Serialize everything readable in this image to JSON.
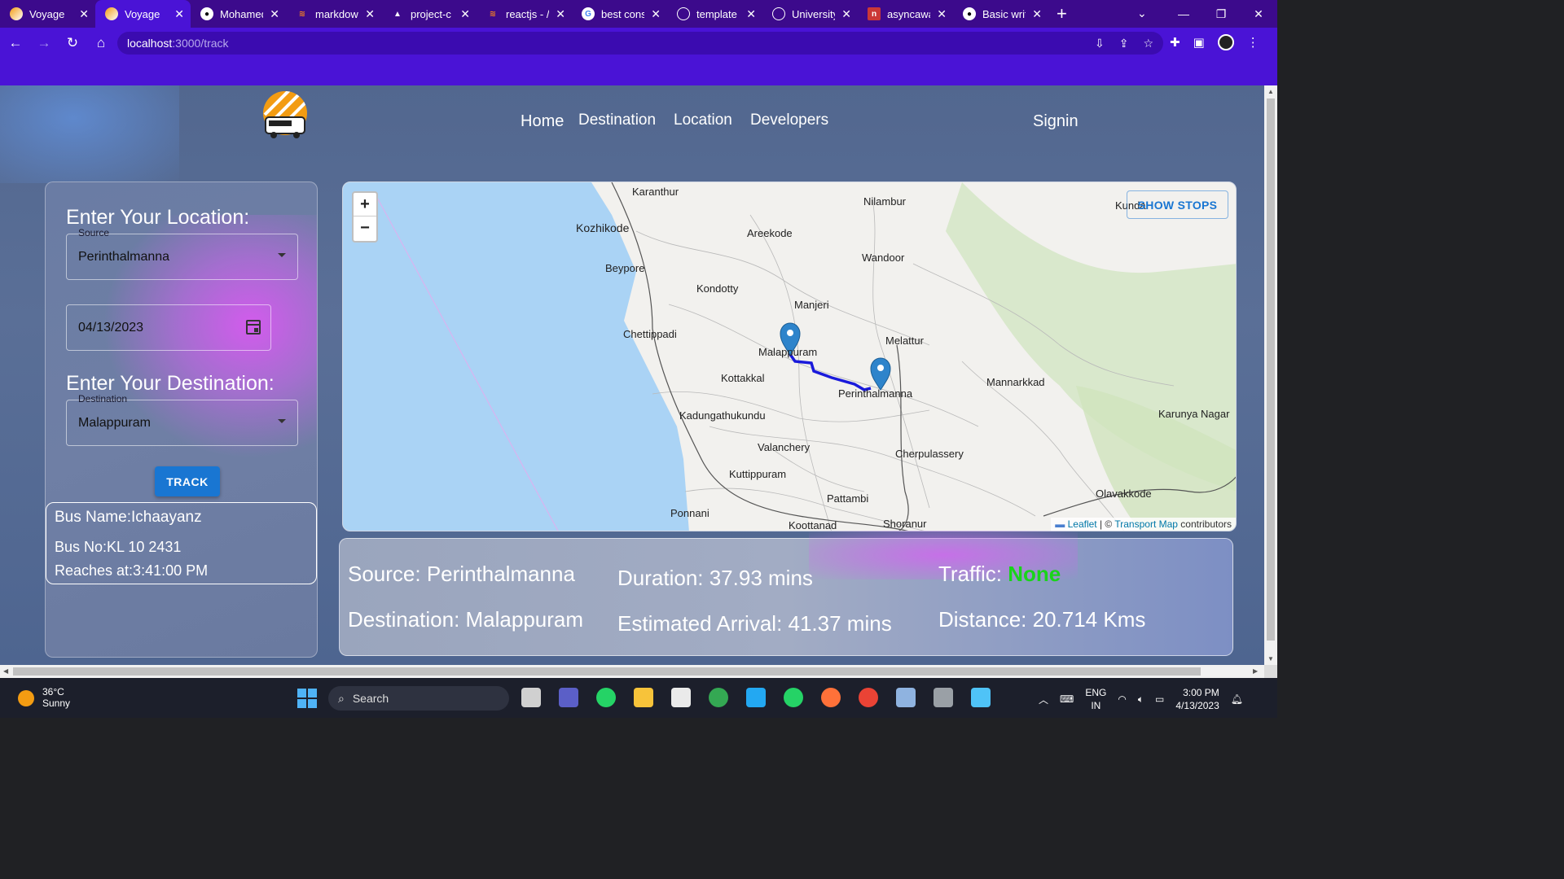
{
  "browser": {
    "tabs": [
      {
        "title": "Voyage",
        "icon": "voyage-favicon",
        "active": false
      },
      {
        "title": "Voyage",
        "icon": "voyage-favicon",
        "active": true
      },
      {
        "title": "Mohamed",
        "icon": "github-icon",
        "active": false
      },
      {
        "title": "markdow",
        "icon": "stackoverflow-icon",
        "active": false
      },
      {
        "title": "project-c",
        "icon": "vercel-icon",
        "active": false
      },
      {
        "title": "reactjs - /",
        "icon": "stackoverflow-icon",
        "active": false
      },
      {
        "title": "best cons",
        "icon": "google-icon",
        "active": false
      },
      {
        "title": "template",
        "icon": "globe-icon",
        "active": false
      },
      {
        "title": "University",
        "icon": "globe-icon",
        "active": false
      },
      {
        "title": "asyncawa",
        "icon": "npm-icon",
        "active": false
      },
      {
        "title": "Basic writ",
        "icon": "github-icon",
        "active": false
      }
    ],
    "url_host": "localhost",
    "url_path": ":3000/track"
  },
  "nav": {
    "home": "Home",
    "destination": "Destination",
    "location": "Location",
    "developers": "Developers",
    "signin": "Signin"
  },
  "form": {
    "location_heading": "Enter Your Location:",
    "source_label": "Source",
    "source_value": "Perinthalmanna",
    "date_value": "04/13/2023",
    "destination_heading": "Enter Your Destination:",
    "destination_label": "Destination",
    "destination_value": "Malappuram",
    "track_label": "TRACK"
  },
  "bus": {
    "name": "Bus Name:Ichaayanz",
    "number": "Bus No:KL 10 2431",
    "reaches": "Reaches at:3:41:00 PM"
  },
  "map": {
    "zoom_in": "+",
    "zoom_out": "−",
    "show_stops": "SHOW STOPS",
    "attribution_leaflet": "Leaflet",
    "attribution_sep": " | © ",
    "attribution_tm": "Transport Map",
    "attribution_tail": " contributors",
    "places": {
      "karanthur": "Karanthur",
      "kozhikode": "Kozhikode",
      "nilambur": "Nilambur",
      "kunda": "Kunda",
      "areekode": "Areekode",
      "beypore": "Beypore",
      "wandoor": "Wandoor",
      "kondotty": "Kondotty",
      "manjeri": "Manjeri",
      "chettippadi": "Chettippadi",
      "malappuram": "Malappuram",
      "melattur": "Melattur",
      "kottakkal": "Kottakkal",
      "perinthalmanna": "Perinthalmanna",
      "mannarkkad": "Mannarkkad",
      "kadungathukundu": "Kadungathukundu",
      "karunya": "Karunya Nagar",
      "valanchery": "Valanchery",
      "cherpulassery": "Cherpulassery",
      "kuttippuram": "Kuttippuram",
      "pattambi": "Pattambi",
      "olavakkode": "Olavakkode",
      "ponnani": "Ponnani",
      "koottanad": "Koottanad",
      "shoranur": "Shoranur"
    }
  },
  "trip": {
    "source": "Source: Perinthalmanna",
    "destination": "Destination: Malappuram",
    "duration": "Duration: 37.93 mins",
    "arrival": "Estimated Arrival: 41.37 mins",
    "traffic_label": "Traffic:",
    "traffic_value": "None",
    "distance": "Distance: 20.714 Kms"
  },
  "taskbar": {
    "temp": "36°C",
    "weather": "Sunny",
    "search": "Search",
    "lang1": "ENG",
    "lang2": "IN",
    "time": "3:00 PM",
    "date": "4/13/2023"
  },
  "colors": {
    "tab_strip": "#3c0a8c",
    "toolbar": "#4a13d6",
    "track_button": "#1976d2",
    "traffic_none": "#19d41a",
    "route": "#1a1adb",
    "sea": "#aad3f5"
  }
}
